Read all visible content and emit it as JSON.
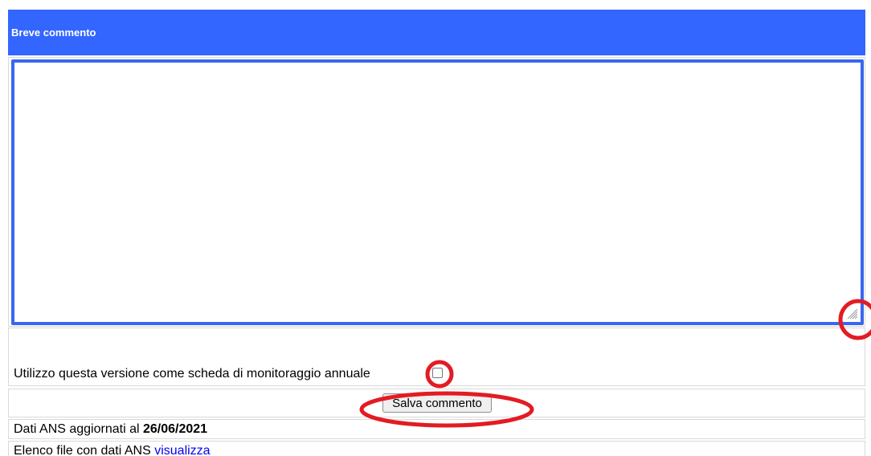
{
  "header": {
    "title": "Breve commento",
    "color": "#3366ff"
  },
  "comment": {
    "value": "",
    "border_color": "#3a67f0",
    "resize_icon": "resize-grip-icon"
  },
  "annual": {
    "label": "Utilizzo questa versione come scheda di monitoraggio annuale",
    "checked": false
  },
  "save": {
    "label": "Salva commento"
  },
  "ans_update": {
    "label": "Dati ANS aggiornati al",
    "date": "26/06/2021"
  },
  "ans_files": {
    "label": "Elenco file con dati ANS",
    "link_label": "visualizza"
  },
  "annotations": {
    "color": "#e31b23",
    "shape": "ellipse"
  }
}
